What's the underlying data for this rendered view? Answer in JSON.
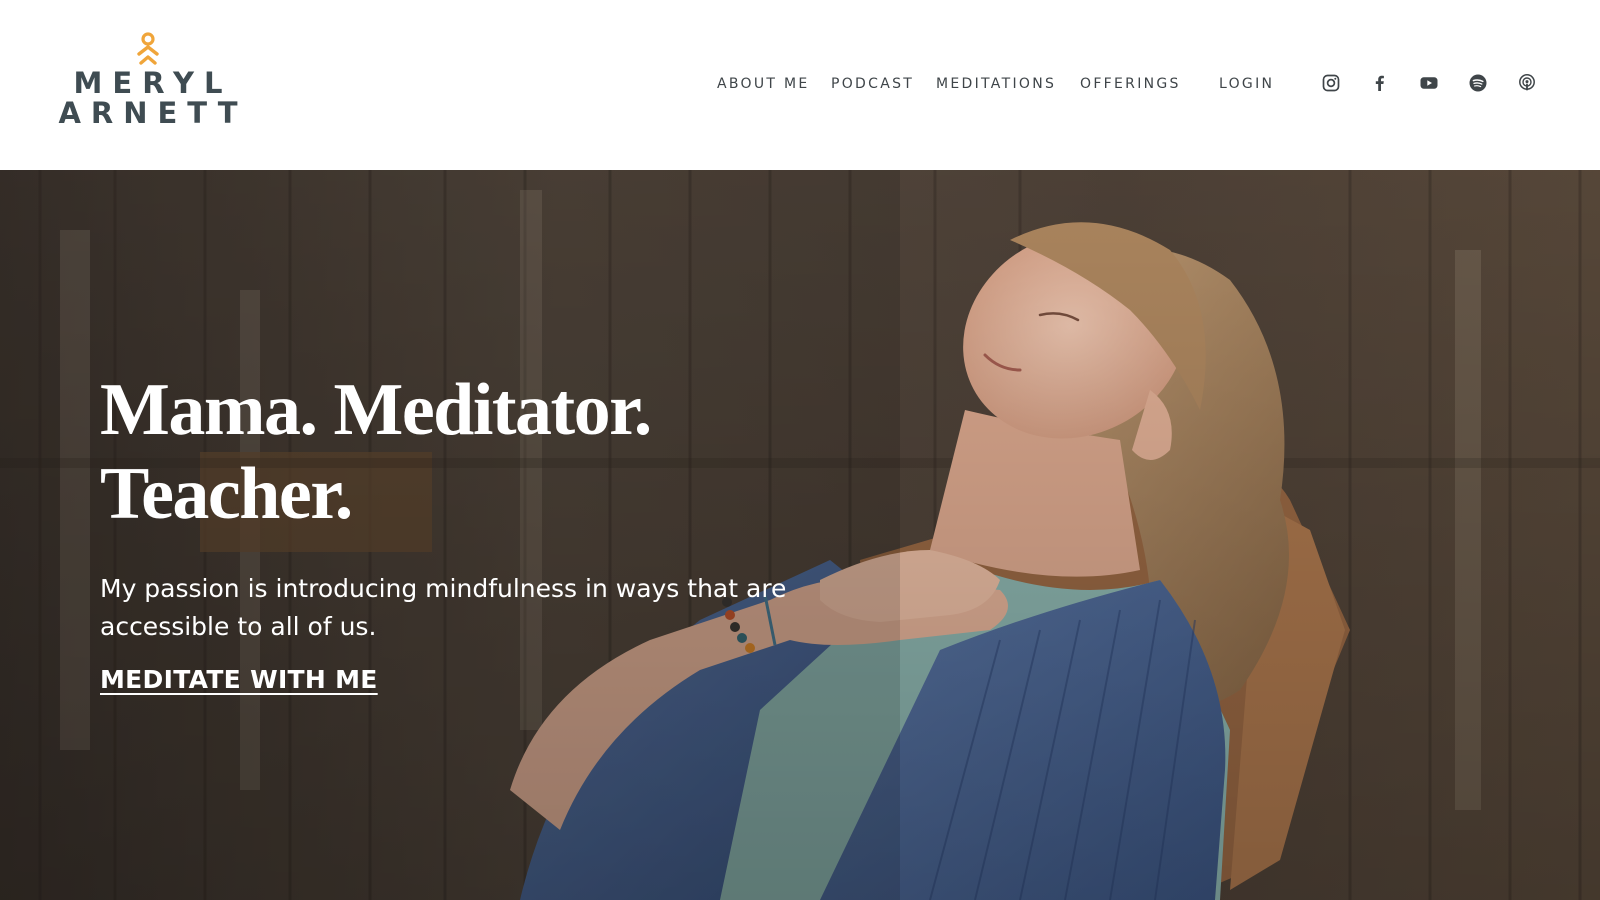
{
  "brand": {
    "line1": "MERYL",
    "line2": "ARNETT",
    "mark_color": "#f0a53a",
    "text_color": "#3f4c52"
  },
  "nav": {
    "items": [
      {
        "label": "ABOUT ME"
      },
      {
        "label": "PODCAST"
      },
      {
        "label": "MEDITATIONS"
      },
      {
        "label": "OFFERINGS"
      }
    ],
    "login_label": "LOGIN"
  },
  "social": [
    {
      "icon": "instagram-icon"
    },
    {
      "icon": "facebook-icon"
    },
    {
      "icon": "youtube-icon"
    },
    {
      "icon": "spotify-icon"
    },
    {
      "icon": "podcast-icon"
    }
  ],
  "hero": {
    "headline_line1": "Mama. Meditator.",
    "headline_line2": "Teacher.",
    "tagline": "My passion is introducing mindfulness in ways that are accessible to all of us.",
    "cta_label": "MEDITATE WITH ME"
  },
  "colors": {
    "nav_text": "#3f4549",
    "hero_text": "#ffffff",
    "fence": "#4e4237"
  }
}
